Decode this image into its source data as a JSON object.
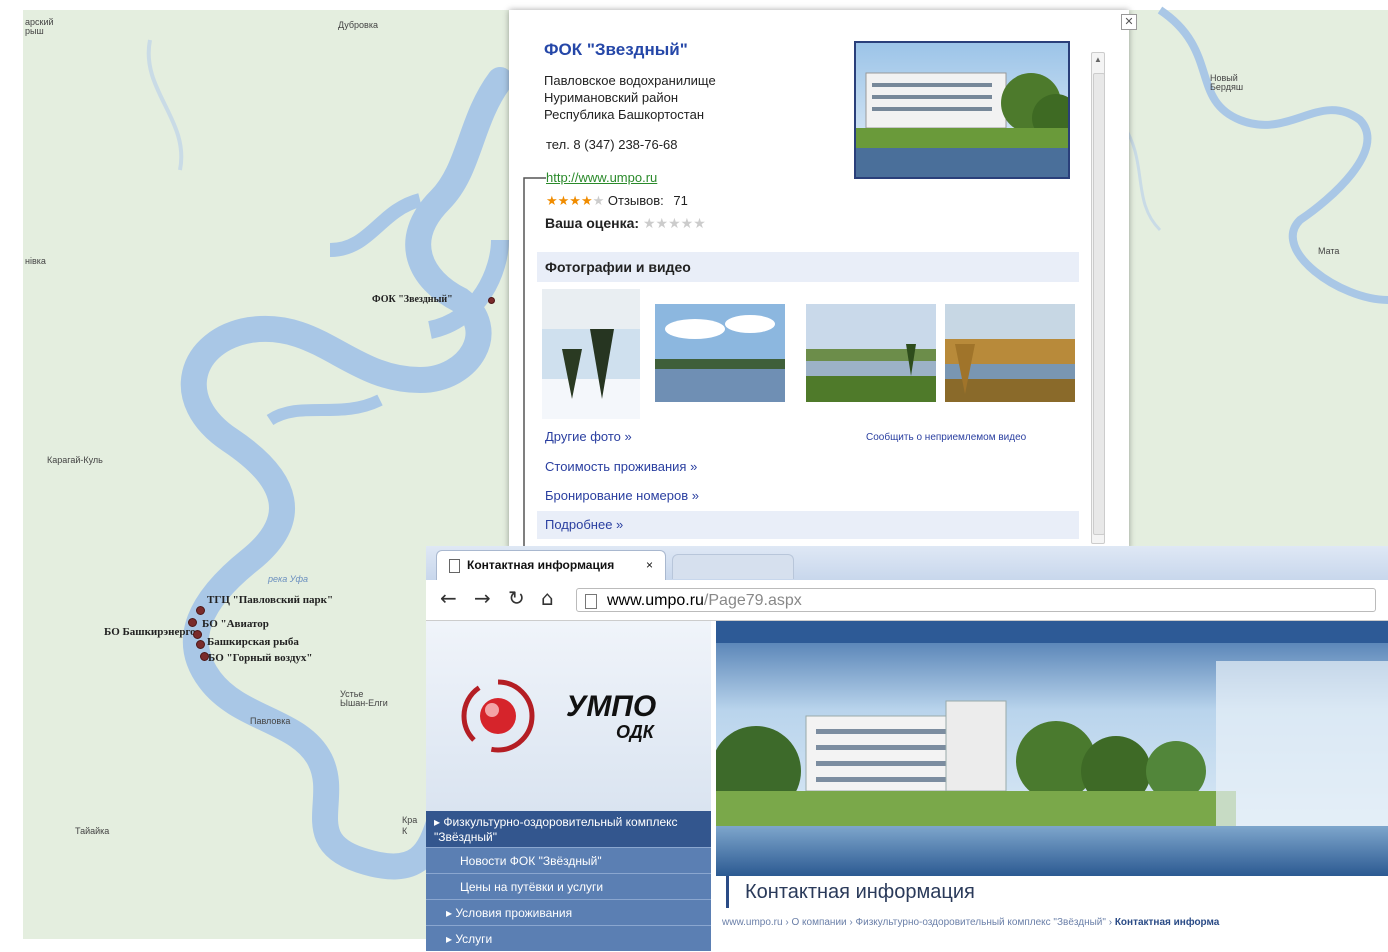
{
  "map": {
    "labels": {
      "top_left": "арский\nрыш",
      "dubrovka": "Дубровка",
      "novka": "нівка",
      "karagay": "Карагай-Куль",
      "reka": "река Уфа",
      "pavlovka": "Павловка",
      "ustie": "Устье\nЫшан-Елги",
      "kr": "Кра\nК",
      "tanayka": "Тайайка",
      "novy": "Новый\nБердяш",
      "mata": "Мата"
    },
    "places": {
      "fok": "ФОК \"Звездный\"",
      "tgts": "ТГЦ \"Павловский парк\"",
      "aviator": "БО \"Авиатор",
      "bashk": "БО Башкирэнерго",
      "ryba": "Башкирская рыба",
      "gorny": "БО \"Горный воздух\""
    }
  },
  "info": {
    "title": "ФОК \"Звездный\"",
    "address": [
      "Павловское водохранилище",
      "Нуримановский район",
      "Республика Башкортостан"
    ],
    "tel": "тел. 8 (347) 238-76-68",
    "url": "http://www.umpo.ru",
    "reviews_label": "Отзывов:",
    "reviews_count": "71",
    "rating": 4,
    "your_rating_label": "Ваша оценка:",
    "photos_title": "Фотографии и видео",
    "other_photos": "Другие фото »",
    "report": "Сообщить о неприемлемом видео",
    "price": "Стоимость проживания »",
    "booking": "Бронирование номеров »",
    "more": "Подробнее »"
  },
  "browser": {
    "tab_title": "Контактная информация",
    "tab_close": "×",
    "address_host": "www.umpo.ru",
    "address_path": "/Page79.aspx",
    "logo_main": "УМПО",
    "logo_sub": "ОДК",
    "menu_active": "Физкультурно-оздоровительный комплекс \"Звёздный\"",
    "menu_items": [
      "Новости ФОК \"Звёздный\"",
      "Цены на путёвки и услуги",
      "Условия проживания",
      "Услуги"
    ],
    "contact_title": "Контактная информация",
    "crumb": "www.umpo.ru › О компании › Физкультурно-оздоровительный комплекс \"Звёздный\" ›",
    "crumb_current": "Контактная информа"
  },
  "colors": {
    "water": "#a9c7e6",
    "land": "#e6efe2",
    "link": "#2a3fa0",
    "title": "#2547a8"
  }
}
